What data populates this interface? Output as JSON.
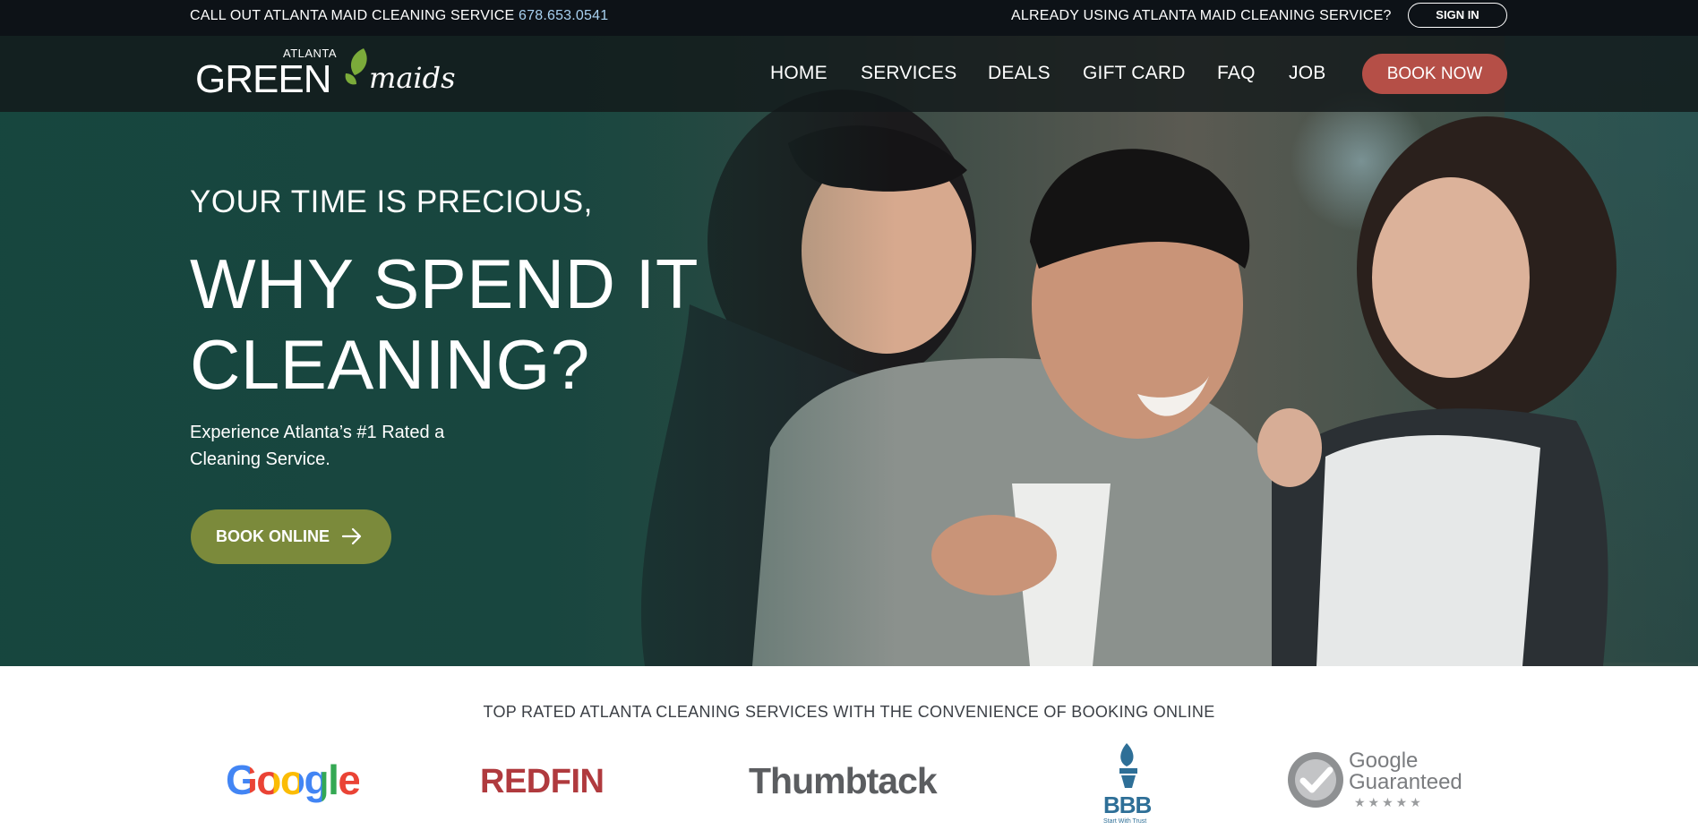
{
  "topbar": {
    "call_text": "CALL OUT ATLANTA MAID CLEANING SERVICE",
    "phone": "678.653.0541",
    "already_text": "ALREADY USING ATLANTA MAID CLEANING SERVICE?",
    "signin_label": "SIGN IN"
  },
  "logo": {
    "small": "ATLANTA",
    "main": "GREEN",
    "script": "maids"
  },
  "nav": {
    "items": [
      {
        "label": "HOME"
      },
      {
        "label": "SERVICES"
      },
      {
        "label": "DEALS"
      },
      {
        "label": "GIFT CARD"
      },
      {
        "label": "FAQ"
      },
      {
        "label": "JOB"
      }
    ],
    "book_now": "BOOK NOW"
  },
  "hero": {
    "pre_heading": "YOUR TIME IS PRECIOUS,",
    "heading": "WHY SPEND IT CLEANING?",
    "subtext": "Experience Atlanta’s #1 Rated a Cleaning Service.",
    "cta": "BOOK ONLINE"
  },
  "trust": {
    "tagline": "TOP RATED ATLANTA CLEANING SERVICES WITH THE CONVENIENCE OF BOOKING ONLINE",
    "brands": {
      "google": "Google",
      "redfin": "REDFIN",
      "thumbtack": "Thumbtack",
      "bbb": "BBB",
      "bbb_sub": "Start With Trust",
      "gg_line1": "Google",
      "gg_line2": "Guaranteed",
      "gg_stars": "★★★★★"
    }
  },
  "colors": {
    "topbar_bg": "#0d1217",
    "book_now": "#b54f47",
    "book_online": "#7b8a3b",
    "hero_overlay": "#16463e",
    "phone": "#a8d1f0"
  }
}
